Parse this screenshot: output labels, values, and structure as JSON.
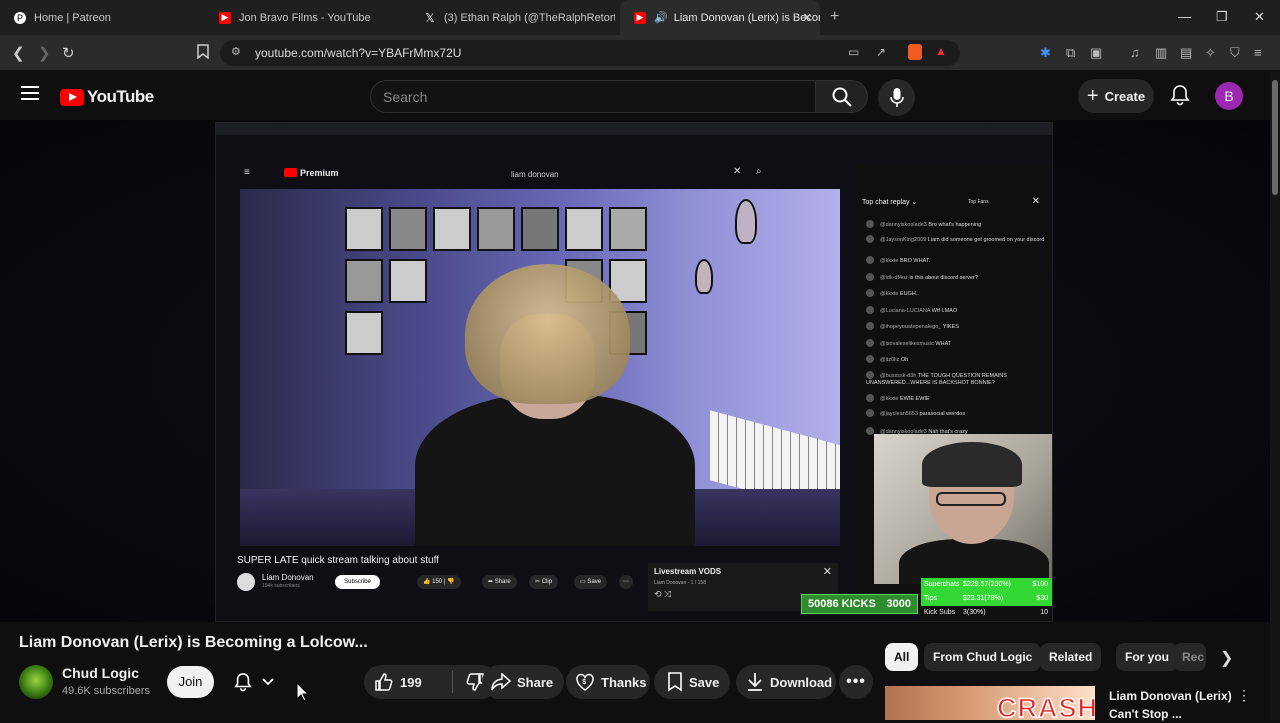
{
  "browser": {
    "tabs": [
      {
        "label": "Home | Patreon",
        "icon": "patreon-icon",
        "color": "#ffffff"
      },
      {
        "label": "Jon Bravo Films - YouTube",
        "icon": "youtube-icon",
        "color": "#ff0000"
      },
      {
        "label": "(3) Ethan Ralph (@TheRalphRetort) /",
        "icon": "x-icon",
        "color": "#ffffff"
      },
      {
        "label": "Liam Donovan (Lerix) is Becom",
        "icon": "youtube-icon",
        "color": "#ff0000",
        "active": true
      }
    ],
    "url": "youtube.com/watch?v=YBAFrMmx72U"
  },
  "youtube": {
    "logo": "YouTube",
    "search_placeholder": "Search",
    "create_label": "Create",
    "avatar_letter": "B"
  },
  "stream": {
    "inner_search": "liam donovan",
    "premium_label": "Premium",
    "title": "SUPER LATE quick stream talking about stuff",
    "channel": "Liam Donovan",
    "subscribe": "Subscribe",
    "likes": "150",
    "share": "Share",
    "clip": "Clip",
    "save": "Save",
    "playlist_title": "Livestream VODS",
    "playlist_sub": "Liam Donovan - 1 / 158",
    "chat_header": "Top chat replay",
    "top_fans": "Top Fans",
    "chat": [
      {
        "user": "@dannyiskoolade3",
        "msg": "Bro what's happening"
      },
      {
        "user": "@JaysonKing2009",
        "msg": "Liam did someone get groomed on your discord"
      },
      {
        "user": "@kkxte",
        "msg": "BRO WHAT."
      },
      {
        "user": "@idk-df4oz",
        "msg": "is this about discord server?"
      },
      {
        "user": "@kkxte",
        "msg": "EUGH.."
      },
      {
        "user": "@Luciana-LUCIANA",
        "msg": "Wtf LMAO"
      },
      {
        "user": "@ihopeyouatepenalego_",
        "msg": "YIKES"
      },
      {
        "user": "@isovaleselikesmusic",
        "msg": "WHAT"
      },
      {
        "user": "@itz0liz",
        "msg": "Oh"
      },
      {
        "user": "@bussssk-d3h",
        "msg": "THE TOUGH QUESTION REMAINS UNANSWERED...WHERE IS BACKSHOT BONNIE?"
      },
      {
        "user": "@kkxte",
        "msg": "EWIE EWIE"
      },
      {
        "user": "@jayclean5653",
        "msg": "parasocial weirdos"
      },
      {
        "user": "@dannyiskoolade3",
        "msg": "Nah that's crazy"
      }
    ],
    "overlay": {
      "kicks_label": "50086 KICKS",
      "kicks_value": "3000",
      "rows": [
        {
          "label": "Superchats",
          "value": "$229.57(230%)",
          "goal": "$100"
        },
        {
          "label": "Tips",
          "value": "$23.31(78%)",
          "goal": "$30"
        },
        {
          "label": "Kick Subs",
          "value": "3(30%)",
          "goal": "10"
        }
      ]
    }
  },
  "video": {
    "title": "Liam Donovan (Lerix) is Becoming a Lolcow...",
    "channel": "Chud Logic",
    "subscribers": "49.6K subscribers",
    "join": "Join",
    "likes": "199",
    "share": "Share",
    "thanks": "Thanks",
    "save": "Save",
    "download": "Download"
  },
  "sidebar": {
    "chips": [
      "All",
      "From Chud Logic",
      "Related",
      "For you",
      "Rec"
    ],
    "recommendation": {
      "thumb_text": "CRASH",
      "title_line1": "Liam Donovan (Lerix)",
      "title_line2": "Can't Stop ..."
    }
  }
}
